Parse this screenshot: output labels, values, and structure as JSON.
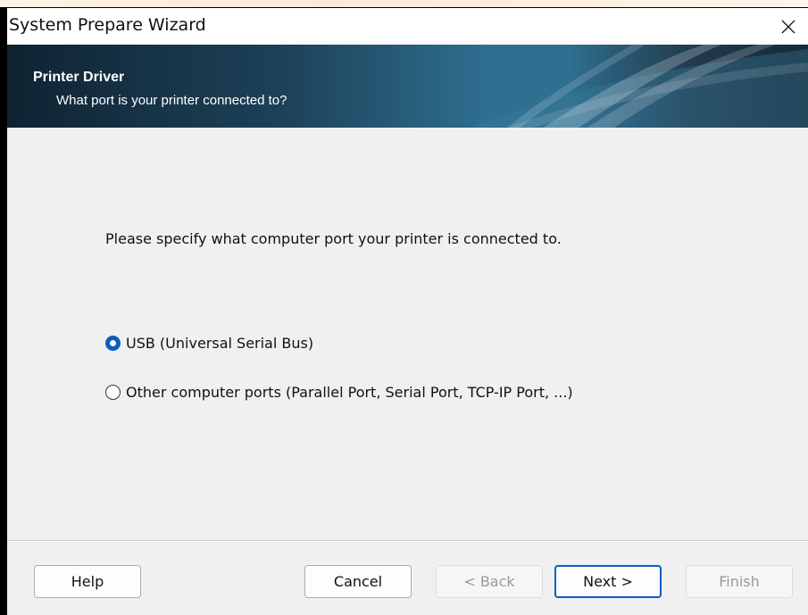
{
  "window": {
    "title": "System Prepare Wizard",
    "close_glyph": "✕"
  },
  "banner": {
    "title": "Printer Driver",
    "subtitle": "What port is your printer connected to?"
  },
  "content": {
    "prompt": "Please specify what computer port your printer is connected to.",
    "options": [
      {
        "label": "USB (Universal Serial Bus)",
        "selected": true
      },
      {
        "label": "Other computer ports (Parallel Port, Serial Port, TCP-IP Port, ...)",
        "selected": false
      }
    ]
  },
  "footer": {
    "help_label": "Help",
    "cancel_label": "Cancel",
    "back_label": "< Back",
    "next_label": "Next >",
    "finish_label": "Finish"
  },
  "colors": {
    "accent": "#0b5cc5",
    "banner_dark": "#0f2332",
    "banner_light": "#2f6f90",
    "dialog_bg": "#f0f0f0"
  },
  "icons": {
    "close": "close-icon",
    "radio_selected": "radio-selected-icon",
    "radio_unselected": "radio-unselected-icon"
  }
}
